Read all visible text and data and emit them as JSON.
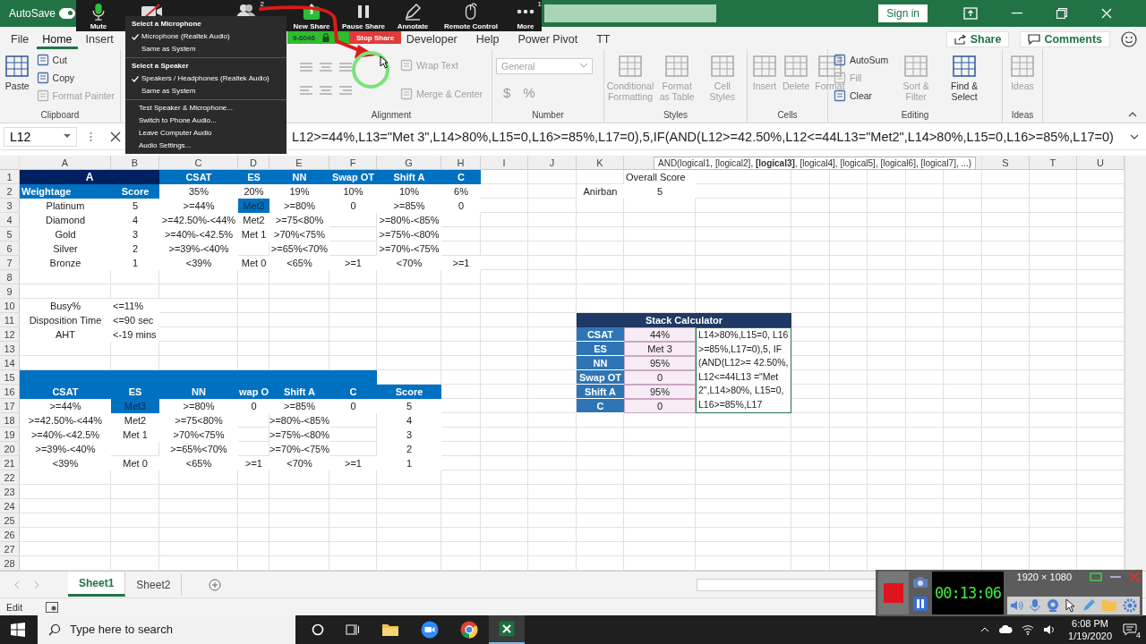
{
  "title_bar": {
    "autosave_label": "AutoSave",
    "autosave_on": true,
    "sign_in": "Sign in"
  },
  "zoom_toolbar": {
    "buttons": [
      {
        "kind": "mic",
        "label": "Mute"
      },
      {
        "kind": "video"
      },
      {
        "kind": "participants",
        "badge": "2"
      },
      {
        "kind": "share",
        "label": "New Share"
      },
      {
        "kind": "pause",
        "label": "Pause Share"
      },
      {
        "kind": "annotate",
        "label": "Annotate"
      },
      {
        "kind": "remote",
        "label": "Remote Control"
      },
      {
        "kind": "more",
        "label": "More",
        "badge": "1"
      }
    ],
    "meeting_id": "9-6046",
    "stop_share": "Stop Share"
  },
  "audio_menu": {
    "sections": [
      {
        "heading": "Select a Microphone",
        "items": [
          {
            "label": "Microphone (Realtek Audio)",
            "checked": true
          },
          {
            "label": "Same as System",
            "checked": false
          }
        ]
      },
      {
        "heading": "Select a Speaker",
        "items": [
          {
            "label": "Speakers / Headphones (Realtek Audio)",
            "checked": true
          },
          {
            "label": "Same as System",
            "checked": false
          }
        ]
      }
    ],
    "actions": [
      "Test Speaker & Microphone...",
      "Switch to Phone Audio...",
      "Leave Computer Audio",
      "Audio Settings..."
    ]
  },
  "ribbon_tabs": [
    {
      "label": "File",
      "selected": false
    },
    {
      "label": "Home",
      "selected": true
    },
    {
      "label": "Insert",
      "selected": false
    },
    {
      "label": "Developer",
      "selected": false
    },
    {
      "label": "Help",
      "selected": false
    },
    {
      "label": "Power Pivot",
      "selected": false
    },
    {
      "label": "TT",
      "selected": false
    }
  ],
  "share": "Share",
  "comments": "Comments",
  "ribbon_groups": [
    {
      "label": "Clipboard",
      "items": [
        {
          "kind": "large",
          "label": "Paste",
          "disabled": false
        },
        {
          "kind": "small",
          "label": "Cut",
          "disabled": false
        },
        {
          "kind": "small",
          "label": "Copy",
          "disabled": false
        },
        {
          "kind": "small",
          "label": "Format Painter",
          "disabled": true
        }
      ]
    },
    {
      "label": "Alignment",
      "items": [
        {
          "kind": "align"
        },
        {
          "kind": "small",
          "label": "Wrap Text",
          "disabled": true
        },
        {
          "kind": "small",
          "label": "Merge & Center",
          "disabled": true
        }
      ]
    },
    {
      "label": "Number",
      "items": [
        {
          "kind": "combo",
          "label": "General",
          "disabled": true
        },
        {
          "kind": "symbols",
          "symbols": [
            "$",
            "%"
          ]
        }
      ]
    },
    {
      "label": "Styles",
      "items": [
        {
          "kind": "large",
          "label": "Conditional Formatting",
          "disabled": true
        },
        {
          "kind": "large",
          "label": "Format as Table",
          "disabled": true
        },
        {
          "kind": "large",
          "label": "Cell Styles",
          "disabled": true
        }
      ]
    },
    {
      "label": "Cells",
      "items": [
        {
          "kind": "large",
          "label": "Insert",
          "disabled": true
        },
        {
          "kind": "large",
          "label": "Delete",
          "disabled": true
        },
        {
          "kind": "large",
          "label": "Format",
          "disabled": true
        }
      ]
    },
    {
      "label": "Editing",
      "items": [
        {
          "kind": "small",
          "label": "AutoSum",
          "disabled": false
        },
        {
          "kind": "small",
          "label": "Fill",
          "disabled": true
        },
        {
          "kind": "small",
          "label": "Clear",
          "disabled": false
        },
        {
          "kind": "large",
          "label": "Sort & Filter",
          "disabled": true
        },
        {
          "kind": "large",
          "label": "Find & Select",
          "disabled": false
        }
      ]
    },
    {
      "label": "Ideas",
      "items": [
        {
          "kind": "large",
          "label": "Ideas",
          "disabled": true
        }
      ]
    }
  ],
  "formula_bar": {
    "name_box": "L12",
    "formula": "L12>=44%,L13=\"Met 3\",L14>80%,L15=0,L16>=85%,L17=0),5,IF(AND(L12>=42.50%,L12<=44L13=\"Met2\",L14>80%,L15=0,L16>=85%,L17=0)"
  },
  "function_tooltip": "AND(logical1, [logical2], **[logical3]**, [logical4], [logical5], [logical6], [logical7], ...)",
  "column_headers": [
    "A",
    "B",
    "C",
    "D",
    "E",
    "F",
    "G",
    "H",
    "I",
    "J",
    "K"
  ],
  "column_headers_right": [
    "S",
    "T",
    "U"
  ],
  "rows": [
    {
      "number": "1",
      "cells": [
        {
          "text": "A",
          "kind": "title"
        },
        {
          "text": "CSAT",
          "kind": "header"
        },
        {
          "text": "ES",
          "kind": "header"
        },
        {
          "text": "NN",
          "kind": "header"
        },
        {
          "text": "Swap OT",
          "kind": "header"
        },
        {
          "text": "Shift A",
          "kind": "header"
        },
        {
          "text": "C",
          "kind": "header"
        },
        null,
        null,
        null,
        {
          "text": "Overall Score",
          "kind": "left"
        }
      ]
    },
    {
      "number": "2",
      "cells": [
        {
          "text": "Weightage",
          "kind": "header-left"
        },
        {
          "text": "Score",
          "kind": "header"
        },
        {
          "text": "35%",
          "kind": "plain"
        },
        {
          "text": "20%",
          "kind": "plain"
        },
        {
          "text": "19%",
          "kind": "plain"
        },
        {
          "text": "10%",
          "kind": "plain"
        },
        {
          "text": "10%",
          "kind": "plain"
        },
        {
          "text": "6%",
          "kind": "plain"
        },
        null,
        null,
        {
          "text": "Anirban",
          "kind": "plain"
        },
        {
          "text": "5",
          "kind": "plain"
        }
      ]
    },
    {
      "number": "3",
      "cells": [
        {
          "text": "Platinum",
          "kind": "plain"
        },
        {
          "text": "5",
          "kind": "plain"
        },
        {
          "text": ">=44%",
          "kind": "plain"
        },
        {
          "text": "Met3",
          "kind": "highlight"
        },
        {
          "text": ">=80%",
          "kind": "plain"
        },
        {
          "text": "0",
          "kind": "plain"
        },
        {
          "text": ">=85%",
          "kind": "plain"
        },
        {
          "text": "0",
          "kind": "plain"
        }
      ]
    },
    {
      "number": "4",
      "cells": [
        {
          "text": "Diamond",
          "kind": "plain"
        },
        {
          "text": "4",
          "kind": "plain"
        },
        {
          "text": ">=42.50%-<44%",
          "kind": "plain"
        },
        {
          "text": "Met2",
          "kind": "plain"
        },
        {
          "text": ">=75<80%",
          "kind": "plain"
        },
        null,
        {
          "text": ">=80%-<85%",
          "kind": "plain"
        }
      ]
    },
    {
      "number": "5",
      "cells": [
        {
          "text": "Gold",
          "kind": "plain"
        },
        {
          "text": "3",
          "kind": "plain"
        },
        {
          "text": ">=40%-<42.5%",
          "kind": "plain"
        },
        {
          "text": "Met 1",
          "kind": "plain"
        },
        {
          "text": ">70%<75%",
          "kind": "plain"
        },
        null,
        {
          "text": ">=75%-<80%",
          "kind": "plain"
        }
      ]
    },
    {
      "number": "6",
      "cells": [
        {
          "text": "Silver",
          "kind": "plain"
        },
        {
          "text": "2",
          "kind": "plain"
        },
        {
          "text": ">=39%-<40%",
          "kind": "plain"
        },
        null,
        {
          "text": ">=65%<70%",
          "kind": "plain"
        },
        null,
        {
          "text": ">=70%-<75%",
          "kind": "plain"
        }
      ]
    },
    {
      "number": "7",
      "cells": [
        {
          "text": "Bronze",
          "kind": "plain"
        },
        {
          "text": "1",
          "kind": "plain"
        },
        {
          "text": "<39%",
          "kind": "plain"
        },
        {
          "text": "Met 0",
          "kind": "plain"
        },
        {
          "text": "<65%",
          "kind": "plain"
        },
        {
          "text": ">=1",
          "kind": "plain"
        },
        {
          "text": "<70%",
          "kind": "plain"
        },
        {
          "text": ">=1",
          "kind": "plain"
        }
      ]
    },
    {
      "number": "8"
    },
    {
      "number": "9"
    },
    {
      "number": "10",
      "cells": [
        {
          "text": "Busy%",
          "kind": "plain"
        },
        {
          "text": "<=11%",
          "kind": "left"
        }
      ]
    },
    {
      "number": "11",
      "cells": [
        {
          "text": "Disposition Time",
          "kind": "plain"
        },
        {
          "text": "<=90 sec",
          "kind": "left"
        },
        null,
        null,
        null,
        null,
        null,
        null,
        null,
        null,
        {
          "text": "Stack Calculator",
          "kind": "calc-title"
        }
      ]
    },
    {
      "number": "12",
      "cells": [
        {
          "text": "AHT",
          "kind": "plain"
        },
        {
          "text": "<-19 mins",
          "kind": "left"
        },
        null,
        null,
        null,
        null,
        null,
        null,
        null,
        null,
        {
          "text": "CSAT",
          "kind": "calc-label"
        },
        {
          "text": "44%",
          "kind": "calc-value"
        },
        {
          "text": "L14>80%,L15=0, L16>=85%,L17=0),5, IF(AND(L12>= 42.50%,L12<=44L13 =\"Met2\",L14>80%, L15=0,L16>=85%,L17",
          "kind": "editing"
        }
      ]
    },
    {
      "number": "13",
      "cells": [
        null,
        null,
        null,
        null,
        null,
        null,
        null,
        null,
        null,
        null,
        {
          "text": "ES",
          "kind": "calc-label"
        },
        {
          "text": "Met 3",
          "kind": "calc-value"
        }
      ]
    },
    {
      "number": "14",
      "cells": [
        null,
        null,
        null,
        null,
        null,
        null,
        null,
        null,
        null,
        null,
        {
          "text": "NN",
          "kind": "calc-label"
        },
        {
          "text": "95%",
          "kind": "calc-value"
        }
      ]
    },
    {
      "number": "15",
      "cells": [
        {
          "kind": "band"
        },
        null,
        null,
        null,
        null,
        {
          "text": "Swap OT",
          "kind": "calc-label"
        },
        {
          "text": "0",
          "kind": "calc-value"
        }
      ]
    },
    {
      "number": "16",
      "cells": [
        {
          "text": "CSAT",
          "kind": "header"
        },
        {
          "text": "ES",
          "kind": "header"
        },
        {
          "text": "NN",
          "kind": "header"
        },
        {
          "text": "wap O",
          "kind": "header"
        },
        {
          "text": "Shift A",
          "kind": "header"
        },
        {
          "text": "C",
          "kind": "header"
        },
        {
          "text": "Score",
          "kind": "header"
        },
        null,
        null,
        null,
        {
          "text": "Shift A",
          "kind": "calc-label"
        },
        {
          "text": "95%",
          "kind": "calc-value"
        }
      ]
    },
    {
      "number": "17",
      "cells": [
        {
          "text": ">=44%",
          "kind": "plain"
        },
        {
          "text": "Met3",
          "kind": "highlight"
        },
        {
          "text": ">=80%",
          "kind": "plain"
        },
        {
          "text": "0",
          "kind": "plain"
        },
        {
          "text": ">=85%",
          "kind": "plain"
        },
        {
          "text": "0",
          "kind": "plain"
        },
        {
          "text": "5",
          "kind": "plain"
        },
        null,
        null,
        null,
        {
          "text": "C",
          "kind": "calc-label"
        },
        {
          "text": "0",
          "kind": "calc-value"
        }
      ]
    },
    {
      "number": "18",
      "cells": [
        {
          "text": ">=42.50%-<44%",
          "kind": "plain"
        },
        {
          "text": "Met2",
          "kind": "plain"
        },
        {
          "text": ">=75<80%",
          "kind": "plain"
        },
        null,
        {
          "text": ">=80%-<85%",
          "kind": "plain"
        },
        null,
        {
          "text": "4",
          "kind": "plain"
        }
      ]
    },
    {
      "number": "19",
      "cells": [
        {
          "text": ">=40%-<42.5%",
          "kind": "plain"
        },
        {
          "text": "Met 1",
          "kind": "plain"
        },
        {
          "text": ">70%<75%",
          "kind": "plain"
        },
        null,
        {
          "text": ">=75%-<80%",
          "kind": "plain"
        },
        null,
        {
          "text": "3",
          "kind": "plain"
        }
      ]
    },
    {
      "number": "20",
      "cells": [
        {
          "text": ">=39%-<40%",
          "kind": "plain"
        },
        null,
        {
          "text": ">=65%<70%",
          "kind": "plain"
        },
        null,
        {
          "text": ">=70%-<75%",
          "kind": "plain"
        },
        null,
        {
          "text": "2",
          "kind": "plain"
        }
      ]
    },
    {
      "number": "21",
      "cells": [
        {
          "text": "<39%",
          "kind": "plain"
        },
        {
          "text": "Met 0",
          "kind": "plain"
        },
        {
          "text": "<65%",
          "kind": "plain"
        },
        {
          "text": ">=1",
          "kind": "plain"
        },
        {
          "text": "<70%",
          "kind": "plain"
        },
        {
          "text": ">=1",
          "kind": "plain"
        },
        {
          "text": "1",
          "kind": "plain"
        }
      ]
    },
    {
      "number": "22"
    },
    {
      "number": "23"
    },
    {
      "number": "24"
    },
    {
      "number": "25"
    },
    {
      "number": "26"
    },
    {
      "number": "27"
    },
    {
      "number": "28"
    }
  ],
  "sheet_tabs": [
    {
      "label": "Sheet1",
      "selected": true
    },
    {
      "label": "Sheet2",
      "selected": false
    }
  ],
  "status": "Edit",
  "recorder": {
    "resolution": "1920 × 1080",
    "timer": "00:13:06"
  },
  "taskbar": {
    "search_placeholder": "Type here to search",
    "time": "6:08 PM",
    "date": "1/19/2020",
    "notifications": "4"
  }
}
